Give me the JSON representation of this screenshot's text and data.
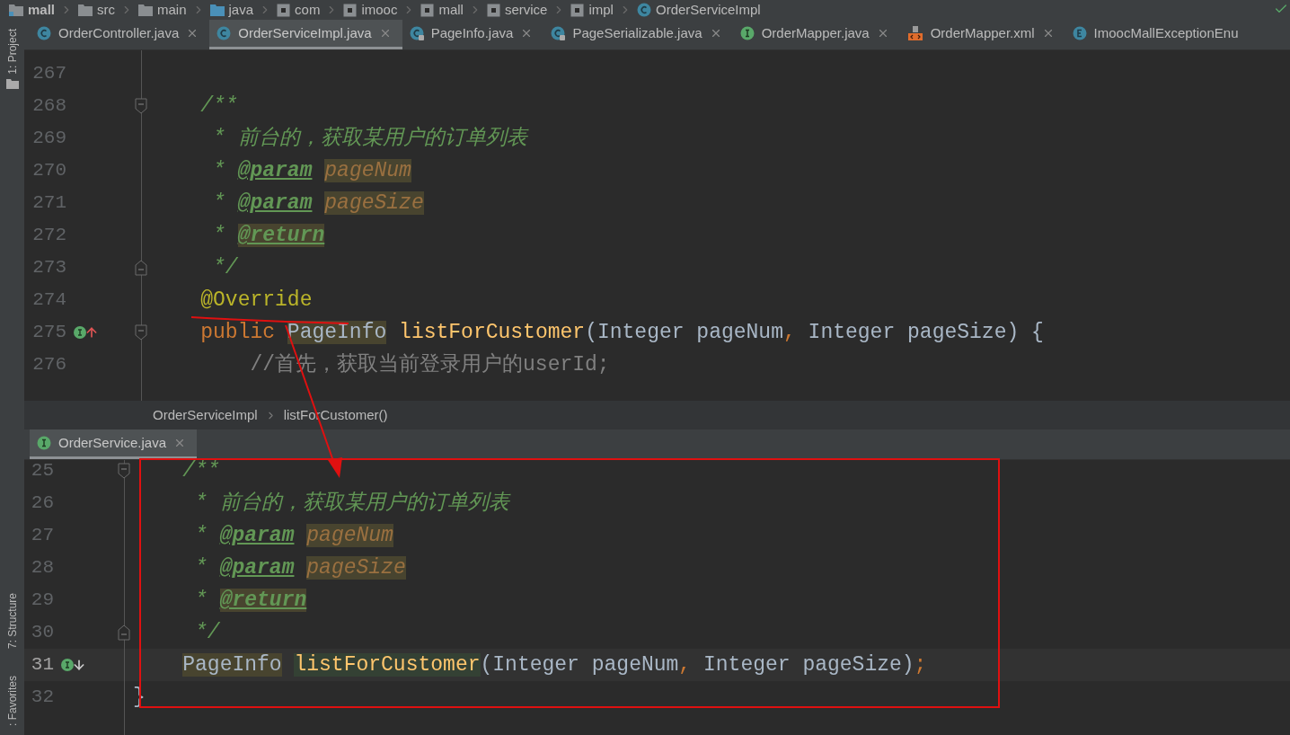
{
  "breadcrumb": [
    {
      "label": "mall",
      "kind": "module",
      "bold": true
    },
    {
      "label": "src",
      "kind": "folder",
      "bold": false
    },
    {
      "label": "main",
      "kind": "folder",
      "bold": false
    },
    {
      "label": "java",
      "kind": "source",
      "bold": false
    },
    {
      "label": "com",
      "kind": "package",
      "bold": false
    },
    {
      "label": "imooc",
      "kind": "package",
      "bold": false
    },
    {
      "label": "mall",
      "kind": "package",
      "bold": false
    },
    {
      "label": "service",
      "kind": "package",
      "bold": false
    },
    {
      "label": "impl",
      "kind": "package",
      "bold": false
    },
    {
      "label": "OrderServiceImpl",
      "kind": "class",
      "bold": false
    }
  ],
  "tool_windows": [
    {
      "label": "1: Project"
    },
    {
      "label": "7: Structure"
    },
    {
      "label": ": Favorites"
    }
  ],
  "top_editor": {
    "tabs": [
      {
        "label": "OrderController.java",
        "kind": "class",
        "selected": false,
        "closable": true
      },
      {
        "label": "OrderServiceImpl.java",
        "kind": "class",
        "selected": true,
        "closable": true
      },
      {
        "label": "PageInfo.java",
        "kind": "class-locked",
        "selected": false,
        "closable": true
      },
      {
        "label": "PageSerializable.java",
        "kind": "class-locked",
        "selected": false,
        "closable": true
      },
      {
        "label": "OrderMapper.java",
        "kind": "interface",
        "selected": false,
        "closable": true
      },
      {
        "label": "OrderMapper.xml",
        "kind": "xml",
        "selected": false,
        "closable": true
      },
      {
        "label": "ImoocMallExceptionEnu",
        "kind": "enum",
        "selected": false,
        "closable": false
      }
    ],
    "lines": [
      {
        "number": "267",
        "kind": "text",
        "current": false
      },
      {
        "number": "268",
        "kind": "fold-start",
        "current": false,
        "tokens": [
          {
            "kind": "doc",
            "text": "    /**",
            "highlighted": false
          }
        ]
      },
      {
        "number": "269",
        "kind": "text",
        "current": false,
        "tokens": [
          {
            "kind": "doc",
            "text": "     * 前台的，获取某用户的订单列表",
            "highlighted": false
          }
        ]
      },
      {
        "number": "270",
        "kind": "text",
        "current": false,
        "tokens": [
          {
            "kind": "doc",
            "text": "     * ",
            "highlighted": false
          },
          {
            "kind": "doctag",
            "text": "@param",
            "highlighted": false
          },
          {
            "kind": "docparam",
            "text": " pageNum",
            "highlighted": true
          }
        ]
      },
      {
        "number": "271",
        "kind": "text",
        "current": false,
        "tokens": [
          {
            "kind": "doc",
            "text": "     * ",
            "highlighted": false
          },
          {
            "kind": "doctag",
            "text": "@param",
            "highlighted": false
          },
          {
            "kind": "docparam",
            "text": " pageSize",
            "highlighted": true
          }
        ]
      },
      {
        "number": "272",
        "kind": "text",
        "current": false,
        "tokens": [
          {
            "kind": "doc",
            "text": "     * ",
            "highlighted": false
          },
          {
            "kind": "doctag",
            "text": "@return",
            "highlighted": true
          }
        ]
      },
      {
        "number": "273",
        "kind": "fold-end",
        "current": false,
        "tokens": [
          {
            "kind": "doc",
            "text": "     */",
            "highlighted": false
          }
        ]
      },
      {
        "number": "274",
        "kind": "text",
        "current": false,
        "tokens": [
          {
            "kind": "annotation",
            "text": "    @Override",
            "highlighted": false
          }
        ]
      },
      {
        "number": "275",
        "kind": "method-impl",
        "current": false,
        "tokens": [
          {
            "kind": "keyword",
            "text": "    public",
            "highlighted": false
          },
          {
            "kind": "plain",
            "text": " PageInfo",
            "highlighted": true
          },
          {
            "kind": "method",
            "text": " listForCustomer",
            "highlighted": false
          },
          {
            "kind": "plain",
            "text": "(Integer pageNum",
            "highlighted": false
          },
          {
            "kind": "punct",
            "text": ",",
            "highlighted": false
          },
          {
            "kind": "plain",
            "text": " Integer pageSize) {",
            "highlighted": false
          }
        ]
      },
      {
        "number": "276",
        "kind": "text",
        "current": false,
        "tokens": [
          {
            "kind": "linecomment",
            "text": "        //首先，获取当前登录用户的userId;",
            "highlighted": false
          }
        ]
      }
    ]
  },
  "navigation_bar": [
    {
      "label": "OrderServiceImpl"
    },
    {
      "label": "listForCustomer()"
    }
  ],
  "bottom_editor": {
    "tabs": [
      {
        "label": "OrderService.java",
        "kind": "interface",
        "selected": true,
        "closable": true
      }
    ],
    "lines": [
      {
        "number": "25",
        "kind": "fold-start",
        "current": false,
        "tokens": [
          {
            "kind": "doc",
            "text": "    /**",
            "highlighted": false
          }
        ]
      },
      {
        "number": "26",
        "kind": "text",
        "current": false,
        "tokens": [
          {
            "kind": "doc",
            "text": "     * 前台的，获取某用户的订单列表",
            "highlighted": false
          }
        ]
      },
      {
        "number": "27",
        "kind": "text",
        "current": false,
        "tokens": [
          {
            "kind": "doc",
            "text": "     * ",
            "highlighted": false
          },
          {
            "kind": "doctag",
            "text": "@param",
            "highlighted": false
          },
          {
            "kind": "docparam",
            "text": " pageNum",
            "highlighted": true
          }
        ]
      },
      {
        "number": "28",
        "kind": "text",
        "current": false,
        "tokens": [
          {
            "kind": "doc",
            "text": "     * ",
            "highlighted": false
          },
          {
            "kind": "doctag",
            "text": "@param",
            "highlighted": false
          },
          {
            "kind": "docparam",
            "text": " pageSize",
            "highlighted": true
          }
        ]
      },
      {
        "number": "29",
        "kind": "text",
        "current": false,
        "tokens": [
          {
            "kind": "doc",
            "text": "     * ",
            "highlighted": false
          },
          {
            "kind": "doctag",
            "text": "@return",
            "highlighted": true
          }
        ]
      },
      {
        "number": "30",
        "kind": "fold-end",
        "current": false,
        "tokens": [
          {
            "kind": "doc",
            "text": "     */",
            "highlighted": false
          }
        ]
      },
      {
        "number": "31",
        "kind": "method-decl",
        "current": true,
        "tokens": [
          {
            "kind": "plain",
            "text": "    PageInfo",
            "highlighted": true
          },
          {
            "kind": "method",
            "text": " listForCustomer",
            "highlighted": true
          },
          {
            "kind": "plain",
            "text": "(Integer pageNum",
            "highlighted": false
          },
          {
            "kind": "punct",
            "text": ",",
            "highlighted": false
          },
          {
            "kind": "plain",
            "text": " Integer pageSize)",
            "highlighted": false
          },
          {
            "kind": "punct",
            "text": ";",
            "highlighted": false
          }
        ]
      },
      {
        "number": "32",
        "kind": "text",
        "current": false,
        "tokens": [
          {
            "kind": "plain",
            "text": "}",
            "highlighted": false
          }
        ]
      }
    ]
  }
}
